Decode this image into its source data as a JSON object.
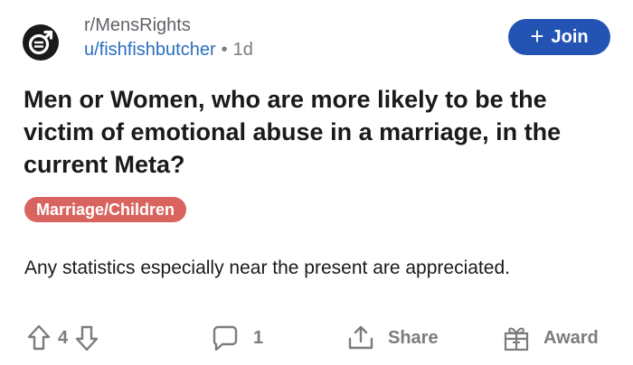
{
  "post": {
    "subreddit": "r/MensRights",
    "username": "u/fishfishbutcher",
    "separator": "•",
    "age": "1d",
    "join_plus": "+",
    "join_label": "Join",
    "title": "Men or Women, who are more likely to be the victim of emotional abuse in a marriage, in the current Meta?",
    "flair": "Marriage/Children",
    "body": "Any statistics especially near the present are appreciated."
  },
  "actions": {
    "vote_count": "4",
    "comment_count": "1",
    "share_label": "Share",
    "award_label": "Award"
  },
  "colors": {
    "join_button": "#2353b3",
    "flair_background": "#d9645f",
    "username_link": "#2a6ebf",
    "muted_text": "#7c7c7c"
  }
}
